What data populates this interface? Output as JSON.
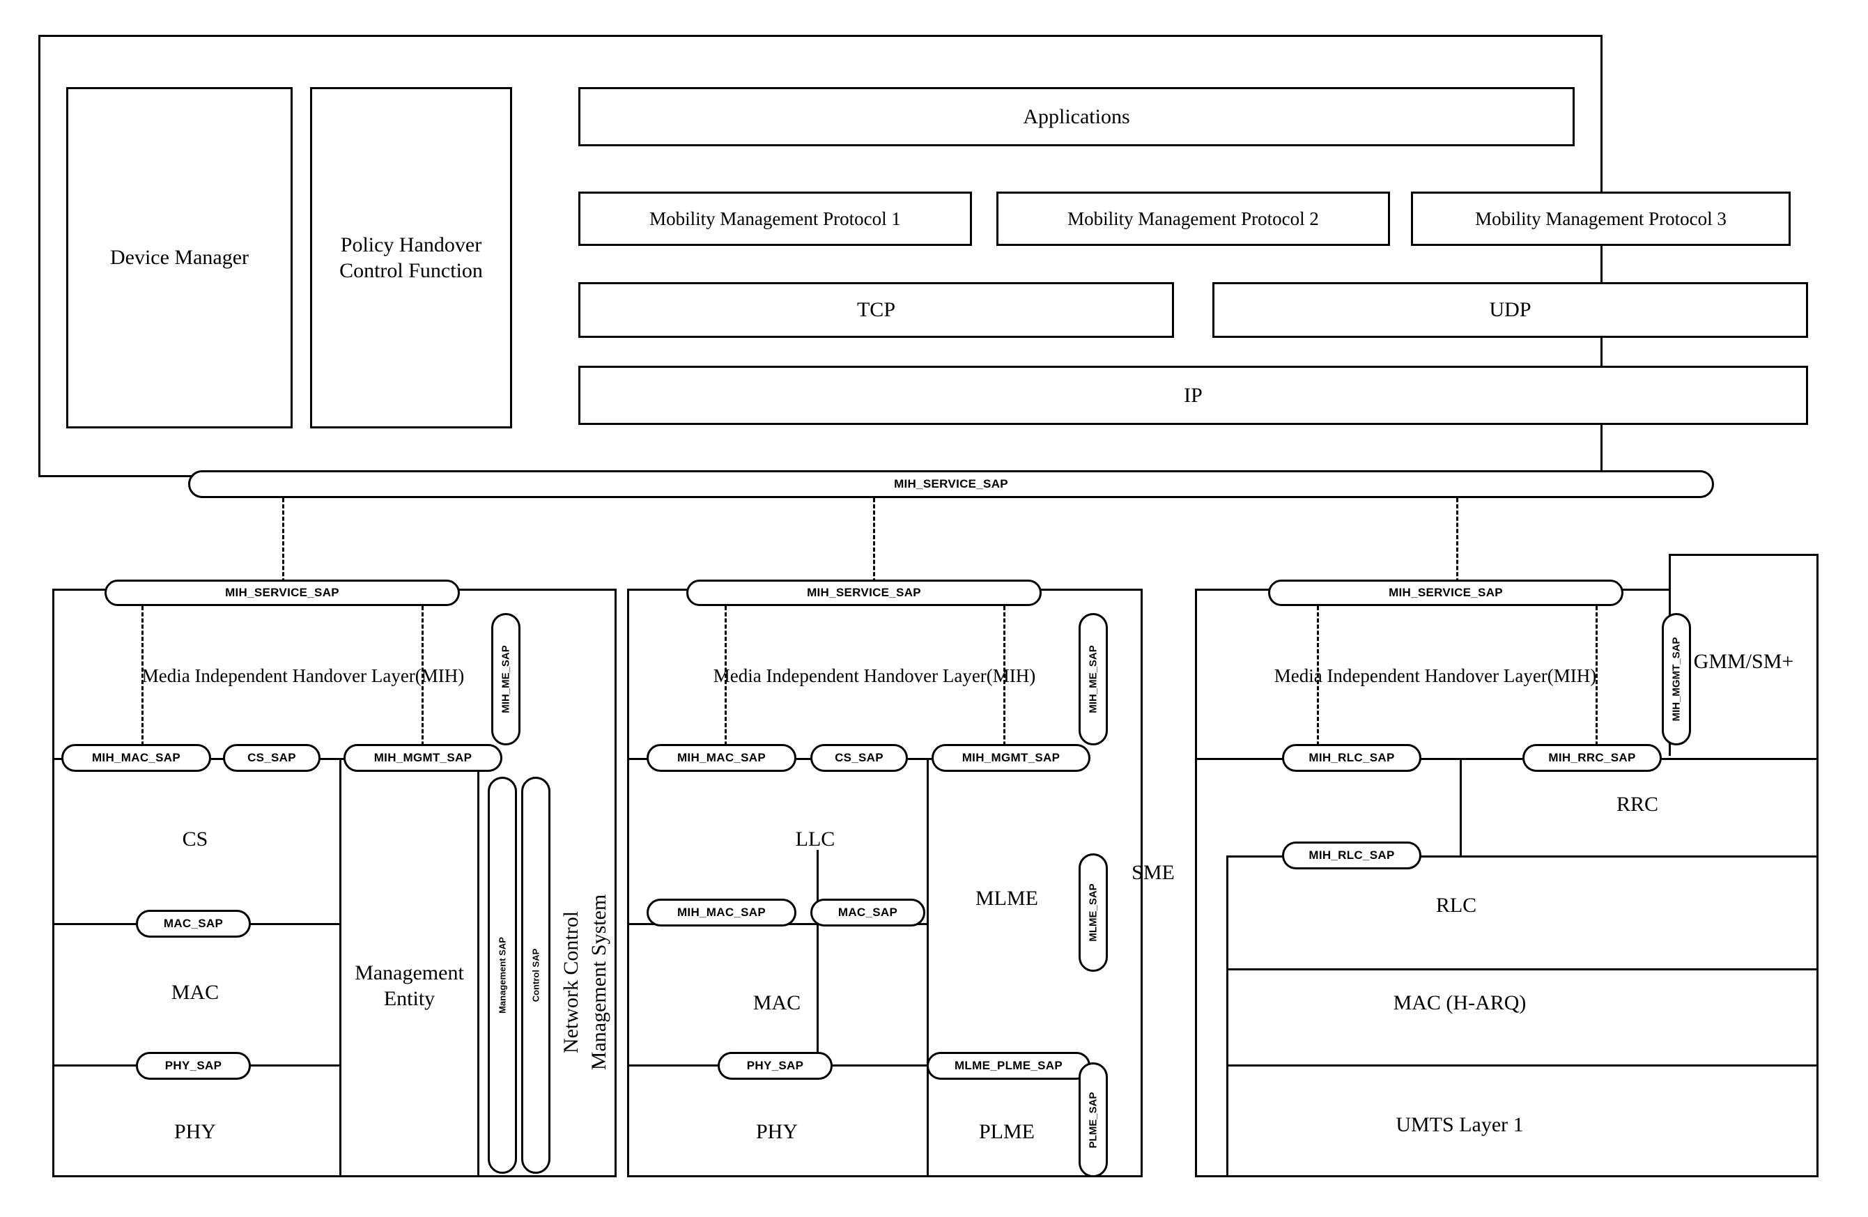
{
  "diagram": {
    "title": "Media Independent Handover (MIH) layered architecture",
    "top": {
      "applications": "Applications",
      "mmp1": "Mobility Management Protocol 1",
      "mmp2": "Mobility Management Protocol 2",
      "mmp3": "Mobility Management Protocol 3",
      "tcp": "TCP",
      "udp": "UDP",
      "ip": "IP",
      "device_manager": "Device Manager",
      "policy_handover": "Policy Handover\nControl Function",
      "policy_handover_line1": "Policy Handover",
      "policy_handover_line2": "Control Function",
      "mih_service_sap": "MIH_SERVICE_SAP"
    },
    "stacks": [
      {
        "id": "stack-left",
        "service_sap": "MIH_SERVICE_SAP",
        "mih_layer": "Media Independent Handover Layer(MIH)",
        "me_sap": "MIH_ME_SAP",
        "saps_row": [
          "MIH_MAC_SAP",
          "CS_SAP",
          "MIH_MGMT_SAP"
        ],
        "layers": [
          "CS",
          "MAC",
          "PHY"
        ],
        "inner_saps": [
          "MAC_SAP",
          "PHY_SAP"
        ],
        "management_entity_line1": "Management",
        "management_entity_line2": "Entity",
        "vertical_saps": [
          "Management SAP",
          "Control SAP"
        ],
        "network_control_line1": "Network Control",
        "network_control_line2": "Management System"
      },
      {
        "id": "stack-middle",
        "service_sap": "MIH_SERVICE_SAP",
        "mih_layer": "Media Independent Handover Layer(MIH)",
        "me_sap": "MIH_ME_SAP",
        "saps_row": [
          "MIH_MAC_SAP",
          "CS_SAP",
          "MIH_MGMT_SAP"
        ],
        "layers": [
          "LLC",
          "MAC",
          "PHY"
        ],
        "right_layers": [
          "MLME",
          "PLME"
        ],
        "inner_saps": [
          "MIH_MAC_SAP",
          "MAC_SAP",
          "PHY_SAP",
          "MLME_PLME_SAP"
        ],
        "vertical_saps": [
          "MLME_SAP",
          "PLME_SAP"
        ],
        "sme": "SME"
      },
      {
        "id": "stack-right",
        "service_sap": "MIH_SERVICE_SAP",
        "mih_layer": "Media Independent Handover Layer(MIH)",
        "mgmt_sap": "MIH_MGMT_SAP",
        "gmm_sm": "GMM/SM+",
        "saps_row": [
          "MIH_RLC_SAP",
          "MIH_RRC_SAP"
        ],
        "extra_sap": "MIH_RLC_SAP",
        "layers": [
          "RRC",
          "RLC",
          "MAC (H-ARQ)",
          "UMTS Layer 1"
        ]
      }
    ]
  }
}
